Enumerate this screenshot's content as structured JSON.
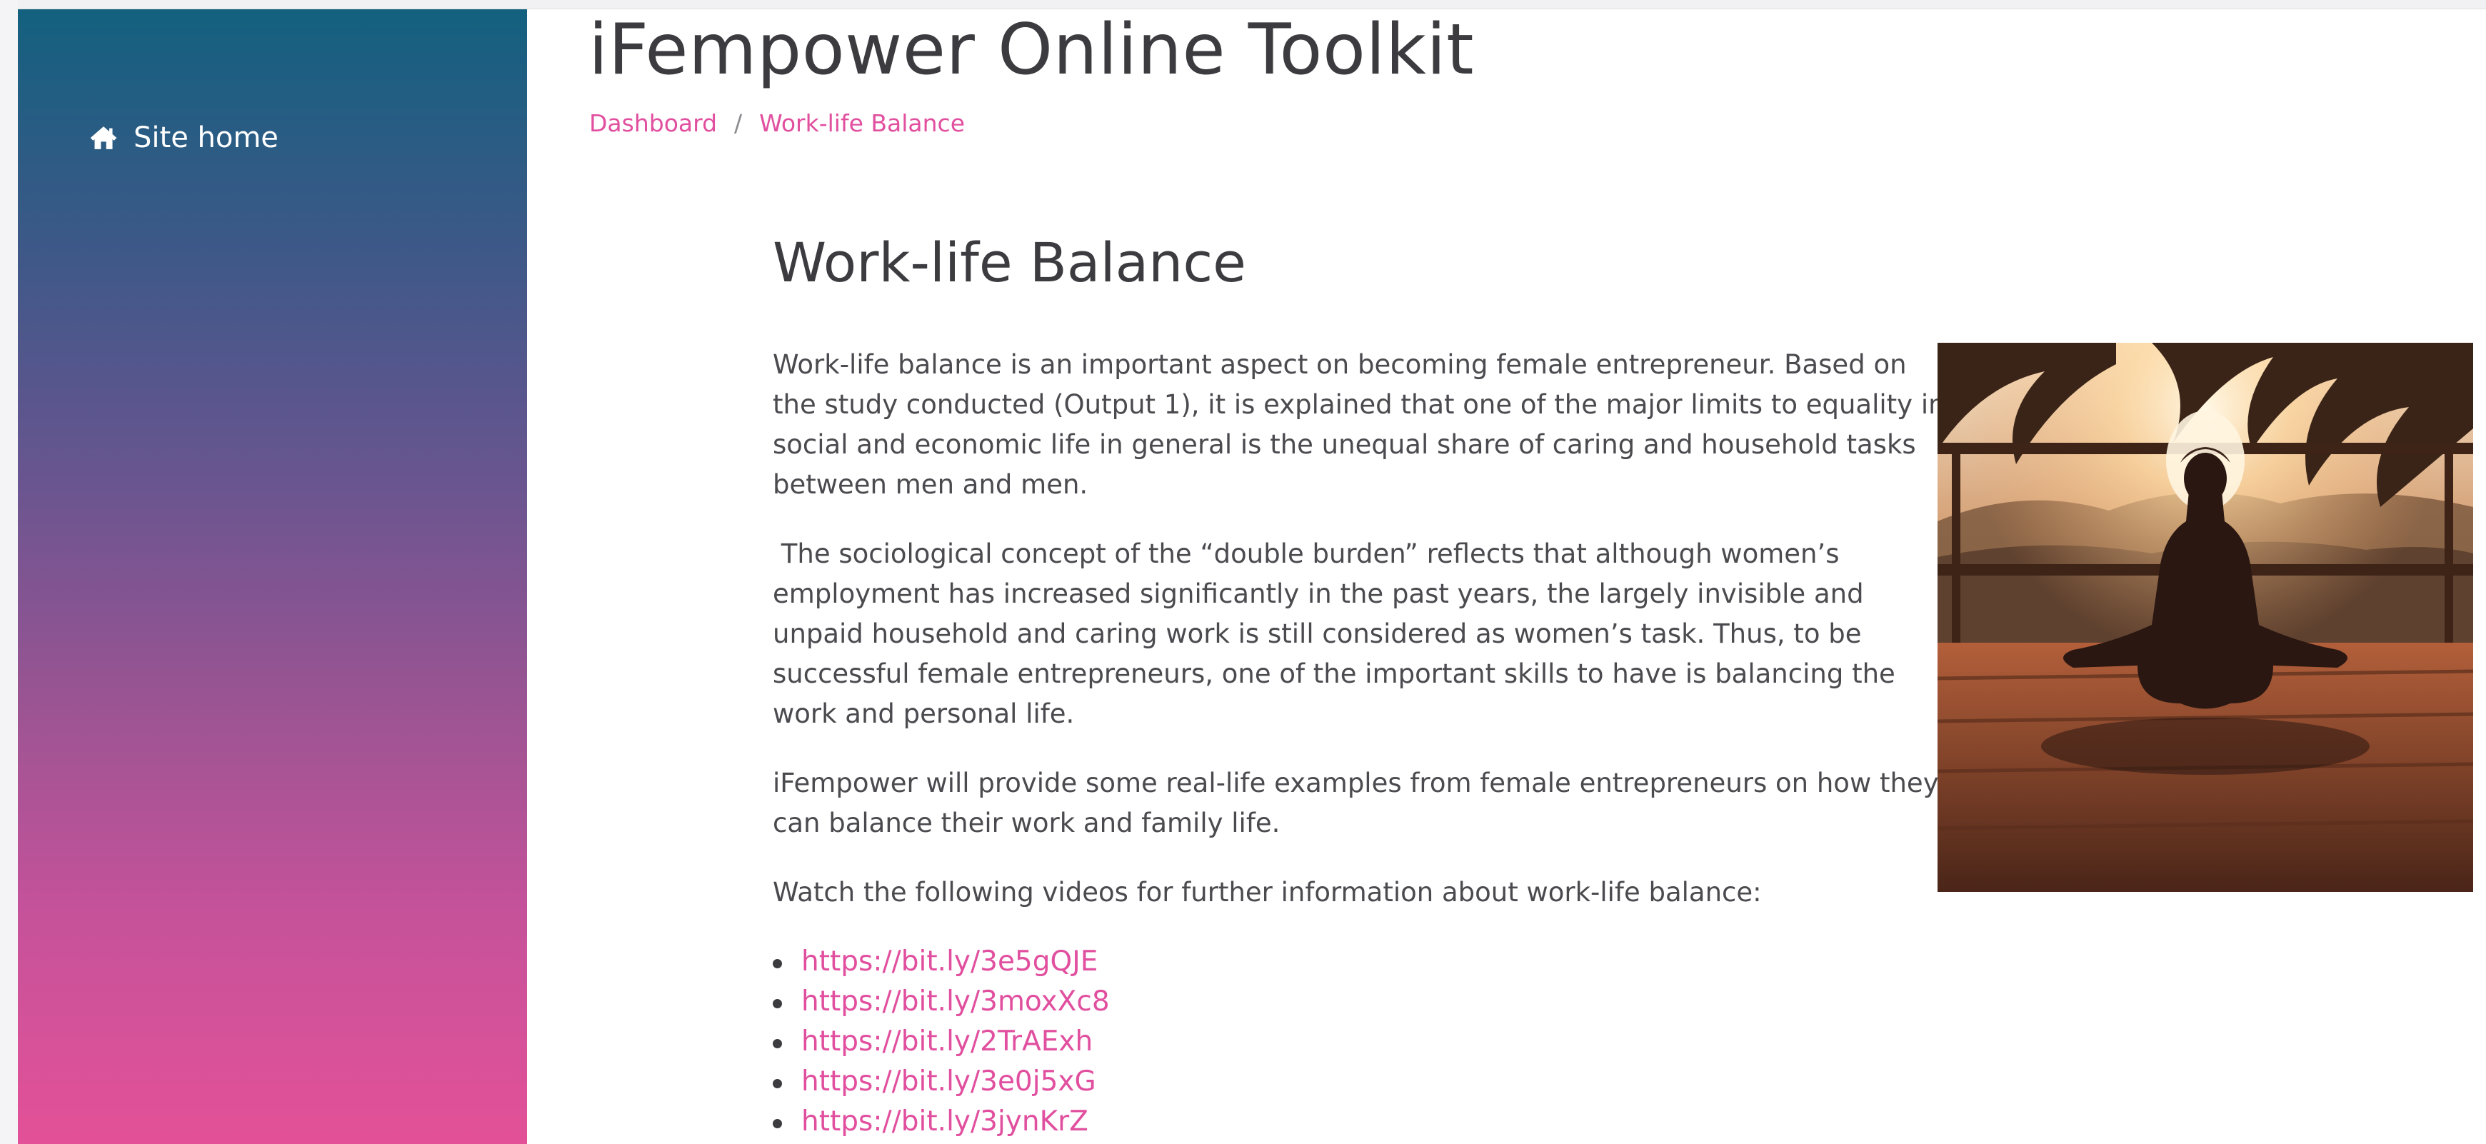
{
  "sidebar": {
    "site_home_label": "Site home",
    "site_home_icon": "home-icon"
  },
  "header": {
    "site_title": "iFempower Online Toolkit"
  },
  "breadcrumb": {
    "items": [
      "Dashboard",
      "Work-life Balance"
    ],
    "separator": "/"
  },
  "page": {
    "heading": "Work-life Balance",
    "paragraphs": [
      "Work-life balance is an important aspect on becoming female entrepreneur. Based on the study conducted (Output 1), it is explained that one of the major limits to equality in social and economic life in general is the unequal share of caring and household tasks between men and men.",
      " The sociological concept of the “double burden” reflects that although women’s employment has increased significantly in the past years, the largely invisible and unpaid household and caring work is still considered as women’s task. Thus, to be successful female entrepreneurs, one of the important skills to have is balancing the work and personal life.",
      "iFempower will provide some real-life examples from female entrepreneurs on how they can balance their work and family life.",
      "Watch the following videos for further information about work-life balance:"
    ],
    "links": [
      "https://bit.ly/3e5gQJE",
      "https://bit.ly/3moxXc8",
      "https://bit.ly/2TrAExh",
      "https://bit.ly/3e0j5xG",
      "https://bit.ly/3jynKrZ"
    ]
  },
  "colors": {
    "accent_pink": "#e14f9f",
    "sidebar_top": "#13607f",
    "sidebar_bottom": "#e35198",
    "text": "#4a4a4f"
  }
}
